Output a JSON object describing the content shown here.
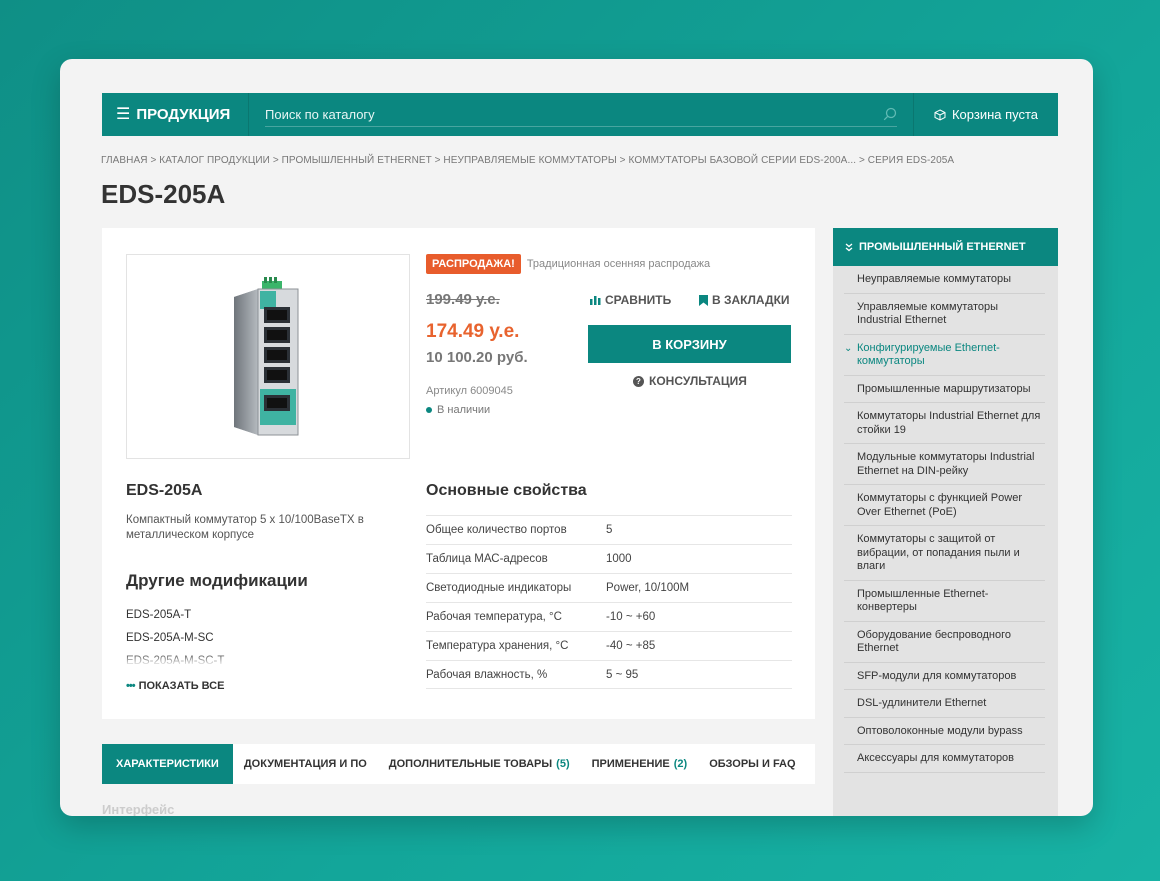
{
  "header": {
    "menu_label": "ПРОДУКЦИЯ",
    "search_placeholder": "Поиск по каталогу",
    "cart_label": "Корзина пуста"
  },
  "breadcrumb": [
    "ГЛАВНАЯ",
    "КАТАЛОГ ПРОДУКЦИИ",
    "ПРОМЫШЛЕННЫЙ ETHERNET",
    "НЕУПРАВЛЯЕМЫЕ КОММУТАТОРЫ",
    "КОММУТАТОРЫ БАЗОВОЙ СЕРИИ EDS-200A...",
    "СЕРИЯ EDS-205A"
  ],
  "page_title": "EDS-205A",
  "product": {
    "sale_badge": "РАСПРОДАЖА!",
    "sale_text": "Традиционная осенняя распродажа",
    "old_price": "199.49 у.е.",
    "new_price": "174.49 у.е.",
    "rub_price": "10 100.20 руб.",
    "sku": "Артикул 6009045",
    "stock": "В наличии",
    "compare_label": "СРАВНИТЬ",
    "bookmark_label": "В ЗАКЛАДКИ",
    "cart_button": "В КОРЗИНУ",
    "consult_label": "КОНСУЛЬТАЦИЯ",
    "name": "EDS-205A",
    "description": "Компактный коммутатор 5 x 10/100BaseTX в металлическом корпусе",
    "mods_title": "Другие модификации",
    "mods": [
      "EDS-205A-T",
      "EDS-205A-M-SC",
      "EDS-205A-M-SC-T"
    ],
    "show_all": "ПОКАЗАТЬ ВСЕ"
  },
  "props": {
    "title": "Основные свойства",
    "rows": [
      {
        "k": "Общее количество портов",
        "v": "5"
      },
      {
        "k": "Таблица МАС-адресов",
        "v": "1000"
      },
      {
        "k": "Светодиодные индикаторы",
        "v": "Power, 10/100M"
      },
      {
        "k": "Рабочая температура, °С",
        "v": "-10 ~ +60"
      },
      {
        "k": "Температура хранения, °С",
        "v": "-40 ~ +85"
      },
      {
        "k": "Рабочая влажность, %",
        "v": "5 ~ 95"
      }
    ]
  },
  "tabs": [
    {
      "label": "ХАРАКТЕРИСТИКИ",
      "count": ""
    },
    {
      "label": "ДОКУМЕНТАЦИЯ И ПО",
      "count": ""
    },
    {
      "label": "ДОПОЛНИТЕЛЬНЫЕ ТОВАРЫ",
      "count": "(5)"
    },
    {
      "label": "ПРИМЕНЕНИЕ",
      "count": "(2)"
    },
    {
      "label": "ОБЗОРЫ И FAQ",
      "count": ""
    }
  ],
  "below_hint": "Интерфейс",
  "sidebar": {
    "title": "ПРОМЫШЛЕННЫЙ ETHERNET",
    "items": [
      "Неуправляемые коммутаторы",
      "Управляемые коммутаторы Industrial Ethernet",
      "Конфигурируемые Ethernet-коммутаторы",
      "Промышленные маршрутизаторы",
      "Коммутаторы Industrial Ethernet для стойки 19",
      "Модульные коммутаторы Industrial Ethernet на DIN-рейку",
      "Коммутаторы с функцией Power Over Ethernet (PoE)",
      "Коммутаторы с защитой от вибрации, от попадания пыли и влаги",
      "Промышленные Ethernet-конвертеры",
      "Оборудование беспроводного Ethernet",
      "SFP-модули для коммутаторов",
      "DSL-удлинители Ethernet",
      "Оптоволоконные модули bypass",
      "Аксессуары для коммутаторов"
    ],
    "active_index": 2
  },
  "colors": {
    "accent": "#0b8780",
    "sale": "#e85c2c",
    "price": "#e8632e"
  }
}
